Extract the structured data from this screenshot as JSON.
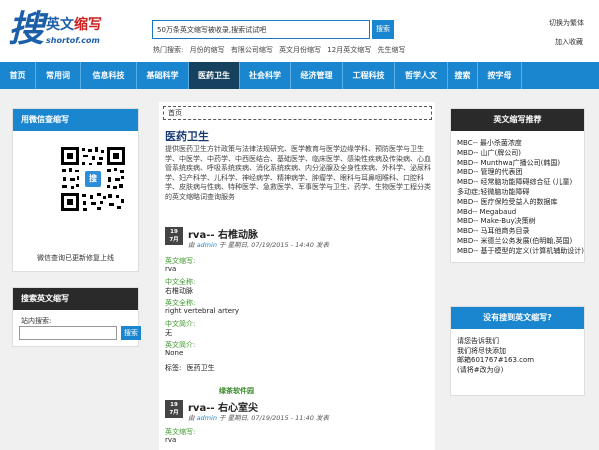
{
  "header": {
    "logo_glyph": "搜",
    "logo_title_black": "英文",
    "logo_title_red": "缩写",
    "logo_sub": "shortof.com",
    "search_placeholder": "50万条英文缩写被收录,搜索试试吧",
    "search_button": "搜索",
    "hot_label": "热门搜索:",
    "hot_items": [
      "月份的缩写",
      "有限公司缩写",
      "英文月份缩写",
      "12月英文缩写",
      "先生缩写"
    ],
    "switch_simplified": "切换为繁体",
    "add_favorite": "加入收藏"
  },
  "nav": {
    "items": [
      "首页",
      "常用词",
      "信息科技",
      "基础科学",
      "医药卫生",
      "社会科学",
      "经济管理",
      "工程科技",
      "哲学人文",
      "搜索",
      "按字母"
    ],
    "active_index": 4
  },
  "left": {
    "wechat_title": "用微信查缩写",
    "wechat_caption": "微信查询已更新修复上线",
    "qr_center_label": "搜",
    "search_title": "搜索英文缩写",
    "search_label": "站内搜索:",
    "search_button": "搜索"
  },
  "main": {
    "breadcrumb": "首页",
    "category_title": "医药卫生",
    "category_desc": "提供医药卫生方针政策与法律法规研究、医学教育与医学边缘学科、预防医学与卫生学、中医学、中药学、中西医结合、基础医学、临床医学、感染性疾病及传染病、心血管系统疾病、呼吸系统疾病、消化系统疾病、内分泌腺及全身性疾病、外科学、泌尿科学、妇产科学、儿科学、神经病学、精神病学、肿瘤学、眼科与耳鼻咽喉科、口腔科学、皮肤病与性病、特种医学、急救医学、军事医学与卫生、药学、生物医学工程分类的英文缩略词查询服务",
    "posts": [
      {
        "day": "19",
        "month": "7月",
        "title": "rva-- 右椎动脉",
        "meta_prefix": "由",
        "author": "admin",
        "meta_middle": "于 星期日, 07/19/2015 - 14:40 发表",
        "fields": [
          {
            "label": "英文缩写:",
            "value": "rva"
          },
          {
            "label": "中文全称:",
            "value": "右椎动脉"
          },
          {
            "label": "英文全称:",
            "value": "right vertebral artery"
          },
          {
            "label": "中文简介:",
            "value": "无"
          },
          {
            "label": "英文简介:",
            "value": "None"
          }
        ],
        "tag_label": "标签:",
        "tag": "医药卫生"
      },
      {
        "day": "19",
        "month": "7月",
        "title": "rva-- 右心室尖",
        "meta_prefix": "由",
        "author": "admin",
        "meta_middle": "于 星期日, 07/19/2015 - 11:40 发表",
        "fields": [
          {
            "label": "英文缩写:",
            "value": "rva"
          }
        ]
      }
    ],
    "watermark": "绿茶软件园"
  },
  "right": {
    "rec_title": "英文缩写推荐",
    "rec_items": [
      "MBC-- 最小杀菌浓度",
      "MBD-- 山广(牌公司)",
      "MBD-- Munthwa广播公司(韩国)",
      "MBD-- 管理的代表团",
      "MBD-- 经常脑功能障碍综合征 (儿童)",
      "MBD-- 医疗保险受益人的数据库",
      "MBd-- Megabaud",
      "MBD-- Make-Buy决策树",
      "MBD-- 马耳他商务目录",
      "MBD-- 米德兰公务发展(伯明翰,英国)",
      "MBD-- 基于模型的定义(计算机辅助设计)"
    ],
    "rec_mid_items": [
      "多动症;轻微脑功能障碍"
    ],
    "notfound_title": "没有搜到英文缩写?",
    "notfound_lines": [
      "请您告诉我们",
      "我们将尽快添加",
      "邮箱601767#163.com",
      "(请将#改为@)"
    ]
  }
}
